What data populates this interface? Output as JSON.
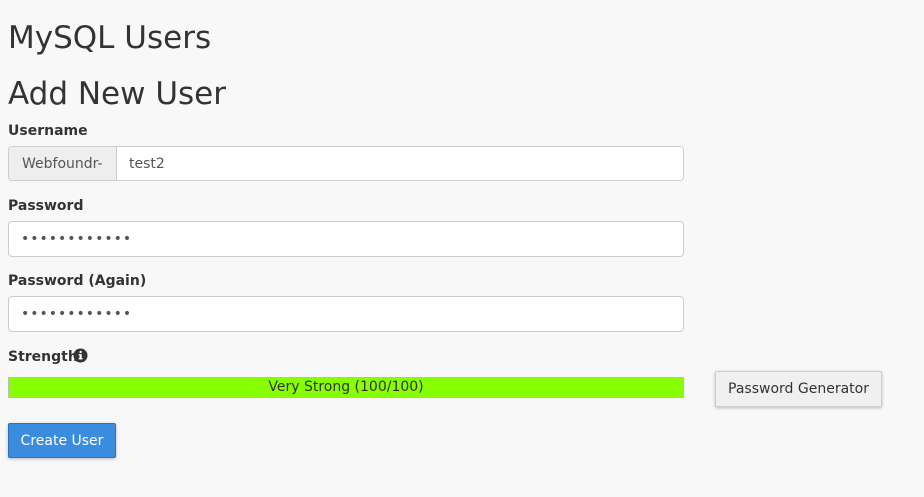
{
  "page": {
    "title": "MySQL Users",
    "section_title": "Add New User"
  },
  "form": {
    "username_label": "Username",
    "username_prefix": "Webfoundr-",
    "username_value": "test2",
    "password_label": "Password",
    "password_value": "••••••••••••",
    "password_again_label": "Password (Again)",
    "password_again_value": "••••••••••••",
    "strength_label": "Strength",
    "strength_text": "Very Strong (100/100)",
    "strength_percent": 100,
    "strength_color": "#88ff00",
    "password_generator_label": "Password Generator",
    "create_user_label": "Create User"
  },
  "icons": {
    "strength_info": "info-icon"
  }
}
